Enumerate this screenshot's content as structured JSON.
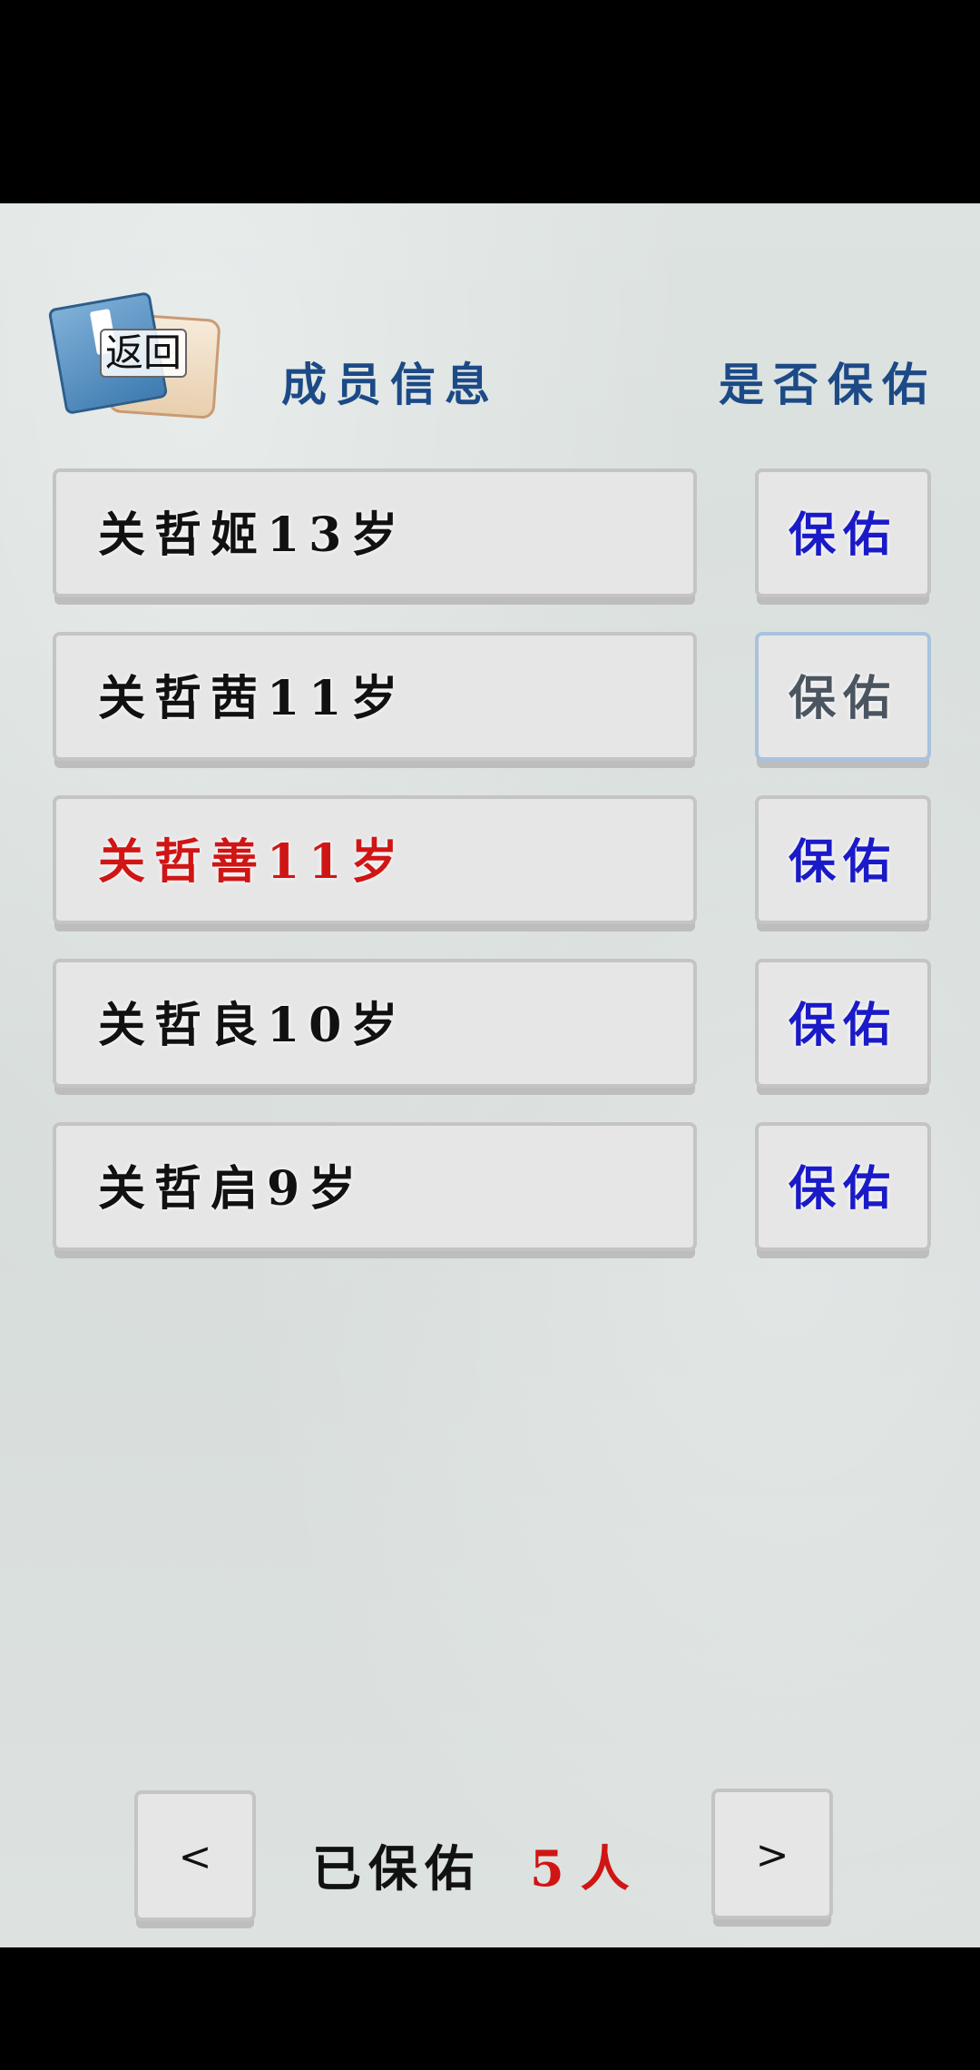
{
  "header": {
    "back_label": "返回",
    "col_member": "成员信息",
    "col_protect": "是否保佑"
  },
  "members": [
    {
      "label": "关哲姬13岁",
      "action": "保佑"
    },
    {
      "label": "关哲茜11岁",
      "action": "保佑"
    },
    {
      "label": "关哲善11岁",
      "action": "保佑"
    },
    {
      "label": "关哲良10岁",
      "action": "保佑"
    },
    {
      "label": "关哲启9岁",
      "action": "保佑"
    }
  ],
  "pager": {
    "prev": "<",
    "next": ">",
    "summary_label": "已保佑",
    "count": "5",
    "unit": "人"
  },
  "colors": {
    "title_blue": "#1c4a86",
    "action_blue": "#1a1ac8",
    "highlight_red": "#d01515"
  }
}
